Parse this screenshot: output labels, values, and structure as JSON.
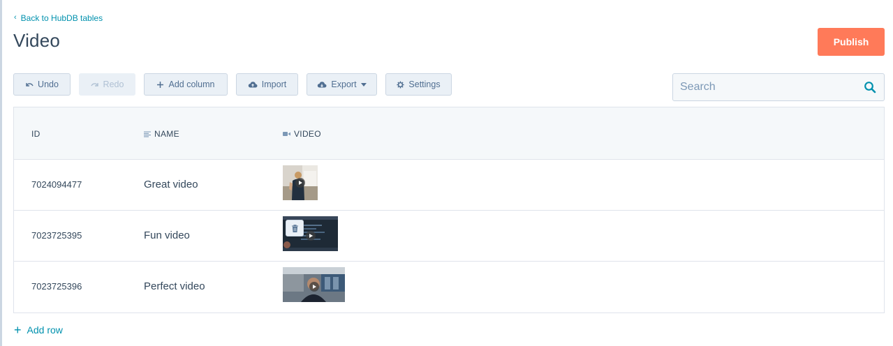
{
  "header": {
    "back_label": "Back to HubDB tables",
    "title": "Video",
    "publish_label": "Publish"
  },
  "toolbar": {
    "undo_label": "Undo",
    "redo_label": "Redo",
    "add_column_label": "Add column",
    "import_label": "Import",
    "export_label": "Export",
    "settings_label": "Settings"
  },
  "search": {
    "placeholder": "Search",
    "value": ""
  },
  "table": {
    "columns": [
      {
        "label": "ID"
      },
      {
        "label": "NAME"
      },
      {
        "label": "VIDEO"
      }
    ],
    "rows": [
      {
        "id": "7024094477",
        "name": "Great video"
      },
      {
        "id": "7023725395",
        "name": "Fun video"
      },
      {
        "id": "7023725396",
        "name": "Perfect video"
      }
    ]
  },
  "footer": {
    "add_row_label": "Add row"
  },
  "colors": {
    "accent": "#0091ae",
    "publish": "#ff7a59",
    "text": "#33475b",
    "border": "#cbd6e2"
  },
  "icons": {
    "back": "chevron-left-icon",
    "undo": "undo-icon",
    "redo": "redo-icon",
    "add": "plus-icon",
    "import": "cloud-upload-icon",
    "export": "cloud-download-icon",
    "settings": "gear-icon",
    "search": "search-icon",
    "name_column": "text-lines-icon",
    "video_column": "video-camera-icon",
    "delete": "trash-icon",
    "play": "play-icon"
  }
}
